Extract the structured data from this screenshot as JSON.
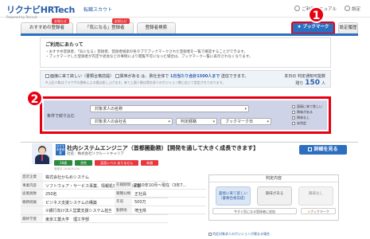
{
  "header": {
    "logo": "リクナビHRTech",
    "logo_sub": "Powered by Recruit",
    "product": "転職スカウト",
    "links": [
      "ご利用マニュアル",
      "設定"
    ]
  },
  "tabs": [
    {
      "label": "おすすめの登録者",
      "badge": "お知らせ"
    },
    {
      "label": "「気になる」登録者",
      "badge": "お知らせ"
    },
    {
      "label": "登録者検索",
      "badge": ""
    },
    {
      "label": "★ ブックマーク",
      "badge": ""
    },
    {
      "label": "設定履歴",
      "badge": ""
    }
  ],
  "notice": {
    "title": "ご利用にあたって",
    "lines": [
      "・おすすめ登録者、「気になる」登録者、登録者検索の各タブでブックマークされた登録者を一覧で確認することができます。",
      "・ブックマークした登録者が内定や退会などの事情により閲覧不可になった場合は、ブックマーク一覧に表示されなくなります。"
    ]
  },
  "status": {
    "cb1": "面接に来て欲しい（書類合格前提）",
    "cb2": "興味がある",
    "mid": "は、貴社全体で",
    "strong": "1日当たり合計1500人まで",
    "tail": "送信できます。",
    "note": "※上記人数はブラウザの更新による値は差し上げます。来て上限人数は貴社求人のポジション数に応じて設定されております。",
    "today_label": "本日の",
    "judge_label": "判定通知可能数",
    "remain_label": "残り",
    "remain_num": "150",
    "remain_unit": "人"
  },
  "filter": {
    "label": "条件で絞り込む",
    "sel_job": "対象求人の名称",
    "sel_company": "対象求人の会社名",
    "sel_route": "判定経路",
    "sel_book": "ブックマーク日",
    "checks": [
      "面接に来て欲しい",
      "興味がある",
      "興味なし",
      "未判定"
    ]
  },
  "markers": [
    "1",
    "2"
  ],
  "card": {
    "rec_tag": "おすすめ登録者",
    "title": "社内システムエンジニア（首都圏勤務）【開発を通して大きく成長できます】",
    "company": "社名：株式会社リクルートキャリア",
    "detail_btn": "詳細を見る",
    "tags": [
      {
        "label": "28歳",
        "color": "#2b8a3e"
      },
      {
        "label": "男性",
        "color": "#2b8a3e"
      },
      {
        "label": "英語レベル ありません",
        "color": "#e8383d"
      },
      {
        "label": "新着",
        "color": "#e8383d"
      }
    ],
    "date": "登録日 2018/01/26",
    "info_left": [
      {
        "k": "直近企業",
        "v": "株式会社かもめシステム"
      },
      {
        "k": "事業内容",
        "v": "ソフトウェア・サービス事業、情報処理機器販売事業"
      },
      {
        "k": "従業員数",
        "v": "250名"
      },
      {
        "k": "職務経験",
        "v": "ビジネス支援システムの構築"
      },
      {
        "k": "",
        "v": "①銀行向け法人営業支援システム担当：同件定義、開発担当"
      },
      {
        "k": "最終学歴",
        "v": "東京工業大学　理工学部"
      }
    ],
    "info_right": [
      {
        "k": "在籍期間",
        "v": "2010年10月〜現在（3年7..."
      },
      {
        "k": "職種分類",
        "v": "正社員"
      },
      {
        "k": "年収",
        "v": "500万"
      },
      {
        "k": "勤務地",
        "v": "埼玉県"
      }
    ],
    "judge": {
      "head": "判定内容",
      "btn1": "面接に来て欲しい",
      "btn1_sub": "（書類合格前提）",
      "btn2": "興味がある",
      "btn3": "興味なし",
      "note": "今すぐ気になる登録者に追加",
      "book": "ブックマーク",
      "link": "判定対象求人のポジションが異なる場合"
    }
  }
}
